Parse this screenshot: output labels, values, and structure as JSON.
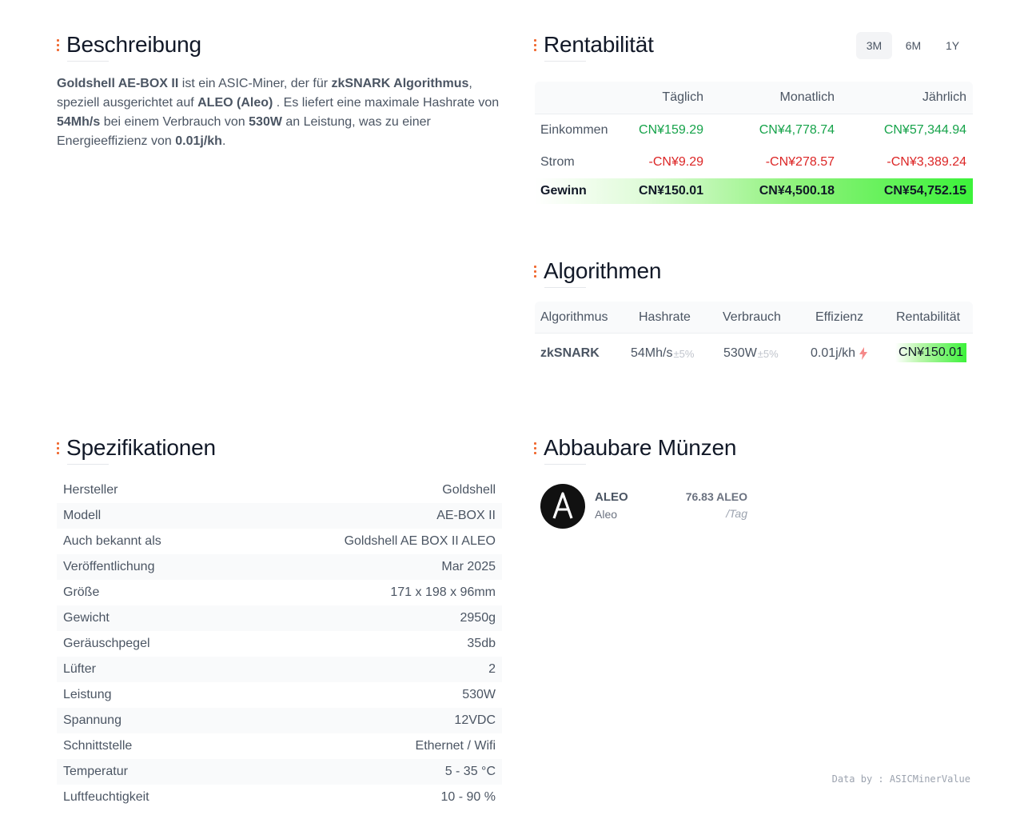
{
  "description": {
    "title": "Beschreibung",
    "parts": [
      {
        "text": "Goldshell AE-BOX II",
        "bold": true
      },
      {
        "text": " ist ein ASIC-Miner, der für ",
        "bold": false
      },
      {
        "text": "zkSNARK Algorithmus",
        "bold": true
      },
      {
        "text": ", speziell ausgerichtet auf ",
        "bold": false
      },
      {
        "text": "ALEO (Aleo)",
        "bold": true
      },
      {
        "text": " . Es liefert eine maximale Hashrate von ",
        "bold": false
      },
      {
        "text": "54Mh/s",
        "bold": true
      },
      {
        "text": " bei einem Verbrauch von ",
        "bold": false
      },
      {
        "text": "530W",
        "bold": true
      },
      {
        "text": " an Leistung, was zu einer Energieeffizienz von ",
        "bold": false
      },
      {
        "text": "0.01j/kh",
        "bold": true
      },
      {
        "text": ".",
        "bold": false
      }
    ]
  },
  "profitability": {
    "title": "Rentabilität",
    "periods": [
      {
        "label": "3M",
        "active": true
      },
      {
        "label": "6M",
        "active": false
      },
      {
        "label": "1Y",
        "active": false
      }
    ],
    "headers": [
      "",
      "Täglich",
      "Monatlich",
      "Jährlich"
    ],
    "rows": [
      {
        "label": "Einkommen",
        "daily": "CN¥159.29",
        "monthly": "CN¥4,778.74",
        "yearly": "CN¥57,344.94",
        "tone": "green"
      },
      {
        "label": "Strom",
        "daily": "-CN¥9.29",
        "monthly": "-CN¥278.57",
        "yearly": "-CN¥3,389.24",
        "tone": "red"
      },
      {
        "label": "Gewinn",
        "daily": "CN¥150.01",
        "monthly": "CN¥4,500.18",
        "yearly": "CN¥54,752.15",
        "tone": "profit"
      }
    ]
  },
  "algorithms": {
    "title": "Algorithmen",
    "headers": [
      "Algorithmus",
      "Hashrate",
      "Verbrauch",
      "Effizienz",
      "Rentabilität"
    ],
    "rows": [
      {
        "name": "zkSNARK",
        "hashrate": "54Mh/s",
        "hashrate_tol": "±5%",
        "power": "530W",
        "power_tol": "±5%",
        "efficiency": "0.01j/kh",
        "profit": "CN¥150.01"
      }
    ]
  },
  "specs": {
    "title": "Spezifikationen",
    "rows": [
      {
        "label": "Hersteller",
        "value": "Goldshell"
      },
      {
        "label": "Modell",
        "value": "AE-BOX II"
      },
      {
        "label": "Auch bekannt als",
        "value": "Goldshell AE BOX II ALEO"
      },
      {
        "label": "Veröffentlichung",
        "value": "Mar 2025"
      },
      {
        "label": "Größe",
        "value": "171 x 198 x 96mm"
      },
      {
        "label": "Gewicht",
        "value": "2950g"
      },
      {
        "label": "Geräuschpegel",
        "value": "35db"
      },
      {
        "label": "Lüfter",
        "value": "2"
      },
      {
        "label": "Leistung",
        "value": "530W"
      },
      {
        "label": "Spannung",
        "value": "12VDC"
      },
      {
        "label": "Schnittstelle",
        "value": "Ethernet / Wifi"
      },
      {
        "label": "Temperatur",
        "value": "5 - 35 °C"
      },
      {
        "label": "Luftfeuchtigkeit",
        "value": "10 - 90 %"
      }
    ]
  },
  "coins": {
    "title": "Abbaubare Münzen",
    "items": [
      {
        "symbol": "ALEO",
        "name": "Aleo",
        "amount": "76.83 ALEO",
        "unit": "/Tag",
        "icon": "aleo-logo-icon"
      }
    ]
  },
  "credit": "Data by : ASICMinerValue",
  "colors": {
    "accent": "#f06a32",
    "positive": "#16a34a",
    "negative": "#dc2626",
    "profit_highlight": "#3cf23a"
  }
}
